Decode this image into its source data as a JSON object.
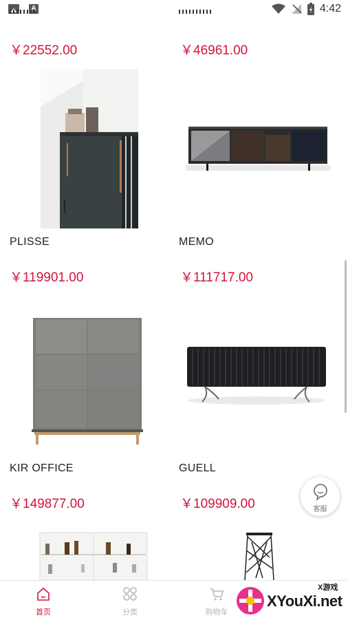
{
  "status_bar": {
    "time": "4:42"
  },
  "products": [
    {
      "name": "",
      "price": "￥22552.00"
    },
    {
      "name": "",
      "price": "￥46961.00"
    },
    {
      "name": "PLISSE",
      "price": "￥119901.00"
    },
    {
      "name": "MEMO",
      "price": "￥111717.00"
    },
    {
      "name": "KIR OFFICE",
      "price": "￥149877.00"
    },
    {
      "name": "GUELL",
      "price": "￥109909.00"
    }
  ],
  "support": {
    "label": "客服",
    "icon": "chat-bubble-icon"
  },
  "tabbar": {
    "items": [
      {
        "label": "首页",
        "icon": "home-icon",
        "active": true
      },
      {
        "label": "分类",
        "icon": "grid-icon",
        "active": false
      },
      {
        "label": "购物车",
        "icon": "cart-icon",
        "active": false
      }
    ]
  },
  "watermark": {
    "site": "XYouXi.net",
    "sub": "X游戏"
  },
  "colors": {
    "price": "#d2143c",
    "active_tab": "#d2143c",
    "inactive_tab": "#b5b5b5"
  }
}
